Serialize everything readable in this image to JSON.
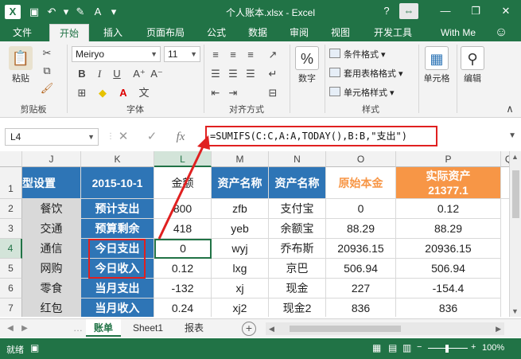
{
  "window": {
    "app_icon": "X",
    "title": "个人账本.xlsx - Excel",
    "help": "?",
    "minimize": "—",
    "restore": "❐",
    "close": "✕"
  },
  "ribbon_tabs": [
    "文件",
    "开始",
    "插入",
    "页面布局",
    "公式",
    "数据",
    "审阅",
    "视图",
    "开发工具"
  ],
  "account": "With Me",
  "ribbon": {
    "clipboard": {
      "label": "剪贴板",
      "paste": "粘贴"
    },
    "font": {
      "label": "字体",
      "name": "Meiryo",
      "size": "11",
      "bold": "B",
      "italic": "I",
      "underline": "U"
    },
    "alignment": {
      "label": "对齐方式"
    },
    "number": {
      "label": "数字",
      "percent": "%"
    },
    "styles": {
      "label": "样式",
      "conditional": "条件格式",
      "table": "套用表格格式",
      "cell": "单元格样式"
    },
    "cells": {
      "label": "单元格"
    },
    "editing": {
      "label": "编辑"
    }
  },
  "formula_bar": {
    "name_box": "L4",
    "formula": "=SUMIFS(C:C,A:A,TODAY(),B:B,\"支出\")",
    "fx": "fx"
  },
  "columns": [
    "J",
    "K",
    "L",
    "M",
    "N",
    "O",
    "P",
    "Q"
  ],
  "rows": [
    "1",
    "2",
    "3",
    "4",
    "5",
    "6",
    "7"
  ],
  "cells": {
    "J": [
      "型设置",
      "餐饮",
      "交通",
      "通信",
      "网购",
      "零食",
      "红包"
    ],
    "K": [
      "2015-10-1",
      "预计支出",
      "预算剩余",
      "今日支出",
      "今日收入",
      "当月支出",
      "当月收入"
    ],
    "L": [
      "金额",
      "800",
      "418",
      "0",
      "0.12",
      "-132",
      "0.24"
    ],
    "M": [
      "资产名称",
      "zfb",
      "yeb",
      "wyj",
      "lxg",
      "xj",
      "xj2"
    ],
    "N": [
      "资产名称",
      "支付宝",
      "余额宝",
      "乔布斯",
      "京巴",
      "现金",
      "现金2"
    ],
    "O": [
      "原始本金",
      "0",
      "88.29",
      "20936.15",
      "506.94",
      "227",
      "836"
    ],
    "P": [
      "实际资产",
      "0.12",
      "88.29",
      "20936.15",
      "506.94",
      "-154.4",
      "836"
    ],
    "P1_total": "21377.1"
  },
  "sheets": [
    "账单",
    "Sheet1",
    "报表"
  ],
  "status": {
    "mode": "就绪",
    "zoom": "100%"
  },
  "colors": {
    "excel_green": "#217346",
    "header_blue": "#2e75b6",
    "label_gray": "#d9d9d9",
    "accent_orange": "#f79646",
    "highlight_red": "#e02020"
  }
}
